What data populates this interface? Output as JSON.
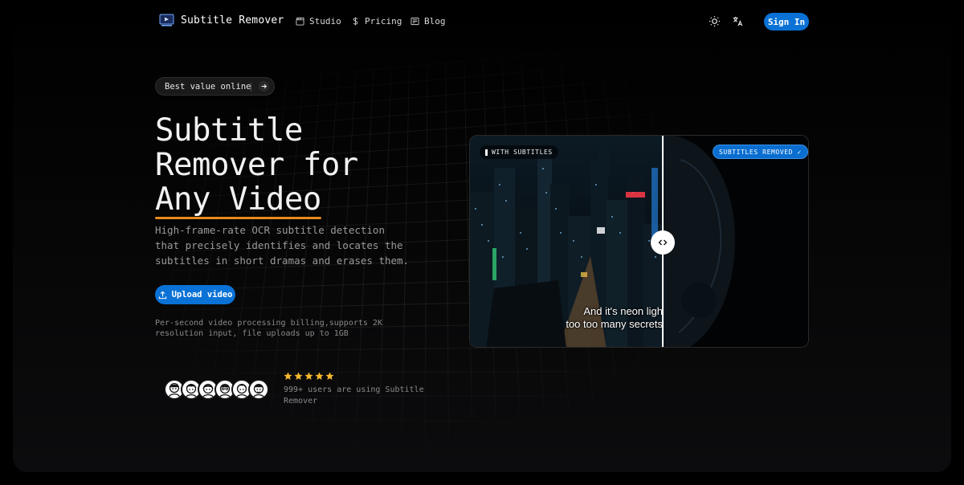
{
  "nav": {
    "brand": "Subtitle Remover",
    "links": [
      {
        "label": "Studio",
        "icon": "clapperboard-icon"
      },
      {
        "label": "Pricing",
        "icon": "dollar-icon"
      },
      {
        "label": "Blog",
        "icon": "newspaper-icon"
      }
    ],
    "sign_in": "Sign In"
  },
  "hero": {
    "pill": "Best value online",
    "headline_line1": "Subtitle",
    "headline_line2": "Remover for",
    "headline_accent": "Any Video",
    "description": "High-frame-rate OCR subtitle detection that precisely identifies and locates the subtitles in short dramas and erases them.",
    "upload_label": "Upload video",
    "note": "Per-second video processing billing,supports 2K resolution input, file uploads up to 1GB",
    "rating_stars": 5,
    "users_text": "999+ users are using Subtitle Remover"
  },
  "compare": {
    "before_label": "WITH SUBTITLES",
    "after_label": "SUBTITLES REMOVED ✓",
    "subtitle_line1": "And it's neon ligh",
    "subtitle_line2": "too too many secrets",
    "divider_position": 0.57
  },
  "colors": {
    "accent": "#0a72d6",
    "underline": "#e88a1a",
    "star": "#f5b82e"
  }
}
